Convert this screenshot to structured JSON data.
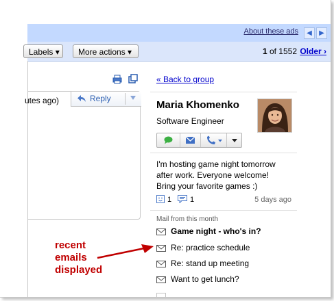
{
  "header": {
    "about_ads": "About these ads",
    "prev_icon": "chevron-left-icon",
    "next_icon": "chevron-right-icon",
    "labels_label": "Labels ▾",
    "more_actions_label": "More actions ▾",
    "pager_current": "1",
    "pager_of": " of 1552 ",
    "older_label": "Older ›"
  },
  "message": {
    "time_fragment": "utes ago)",
    "reply_label": "Reply"
  },
  "sidebar": {
    "back_link": "« Back to group",
    "person_name": "Maria Khomenko",
    "person_title": "Software Engineer",
    "status_lines": [
      "I'm hosting game night tomorrow",
      "after work.  Everyone welcome!",
      "Bring your favorite games :)"
    ],
    "smile_count": "1",
    "comment_count": "1",
    "status_date": "5 days ago",
    "mail_header": "Mail from this month",
    "mails": [
      {
        "subject": "Game night - who's in?",
        "unread": true
      },
      {
        "subject": "Re: practice schedule",
        "unread": false
      },
      {
        "subject": "Re: stand up meeting",
        "unread": false
      },
      {
        "subject": "Want to get lunch?",
        "unread": false
      }
    ]
  },
  "annotation": {
    "lines": [
      "recent",
      "emails",
      "displayed"
    ]
  },
  "colors": {
    "ads_bar": "#c3d9ff",
    "toolbar": "#dbe6fb",
    "link": "#0000cc",
    "annotation": "#c00000"
  }
}
